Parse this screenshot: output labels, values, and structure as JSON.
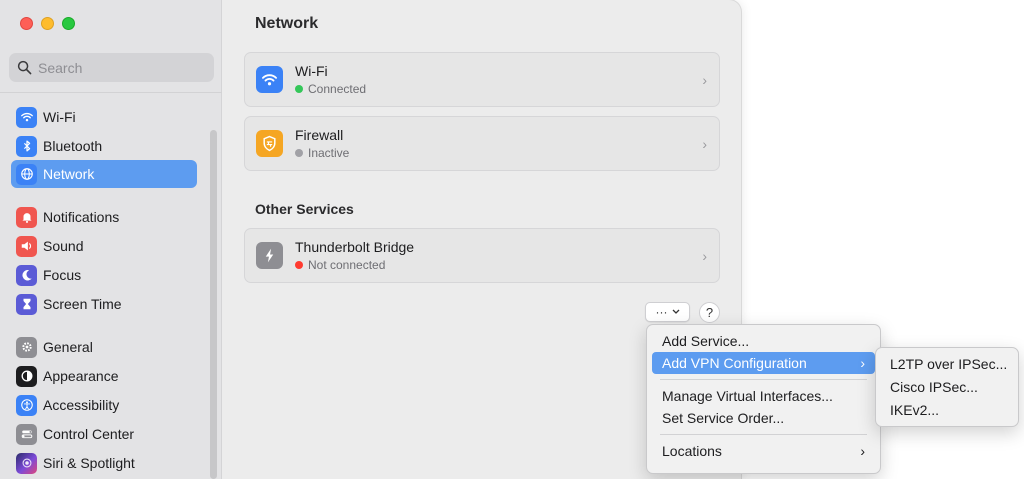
{
  "sidebar": {
    "search_placeholder": "Search",
    "groups": [
      [
        {
          "label": "Wi-Fi",
          "icon": "wifi-icon",
          "color": "#3b82f6"
        },
        {
          "label": "Bluetooth",
          "icon": "bluetooth-icon",
          "color": "#3b82f6"
        },
        {
          "label": "Network",
          "icon": "globe-icon",
          "color": "#3b82f6",
          "active": true
        }
      ],
      [
        {
          "label": "Notifications",
          "icon": "bell-icon",
          "color": "#f0564f"
        },
        {
          "label": "Sound",
          "icon": "speaker-icon",
          "color": "#f0564f"
        },
        {
          "label": "Focus",
          "icon": "moon-icon",
          "color": "#5b5bd6"
        },
        {
          "label": "Screen Time",
          "icon": "hourglass-icon",
          "color": "#5b5bd6"
        }
      ],
      [
        {
          "label": "General",
          "icon": "gear-icon",
          "color": "#8e8e93"
        },
        {
          "label": "Appearance",
          "icon": "appearance-icon",
          "color": "#1d1d1f"
        },
        {
          "label": "Accessibility",
          "icon": "accessibility-icon",
          "color": "#3b82f6"
        },
        {
          "label": "Control Center",
          "icon": "control-center-icon",
          "color": "#8e8e93"
        },
        {
          "label": "Siri & Spotlight",
          "icon": "siri-icon",
          "color": "#7d4bd8"
        }
      ]
    ]
  },
  "main": {
    "title": "Network",
    "services": [
      {
        "title": "Wi-Fi",
        "status": "Connected",
        "status_color": "#34c759",
        "icon": "wifi-icon",
        "icon_color": "#3b82f6"
      },
      {
        "title": "Firewall",
        "status": "Inactive",
        "status_color": "#a1a1a6",
        "icon": "firewall-icon",
        "icon_color": "#f5a623"
      }
    ],
    "other_title": "Other Services",
    "other_services": [
      {
        "title": "Thunderbolt Bridge",
        "status": "Not connected",
        "status_color": "#ff3b30",
        "icon": "thunderbolt-icon",
        "icon_color": "#8e8e93"
      }
    ],
    "more_button_label": "···",
    "help_label": "?"
  },
  "menu": {
    "items": [
      {
        "label": "Add Service..."
      },
      {
        "label": "Add VPN Configuration",
        "submenu": true,
        "highlighted": true
      },
      {
        "label": "Manage Virtual Interfaces..."
      },
      {
        "label": "Set Service Order..."
      },
      {
        "label": "Locations",
        "submenu": true
      }
    ],
    "submenu_items": [
      {
        "label": "L2TP over IPSec..."
      },
      {
        "label": "Cisco IPSec..."
      },
      {
        "label": "IKEv2..."
      }
    ]
  }
}
